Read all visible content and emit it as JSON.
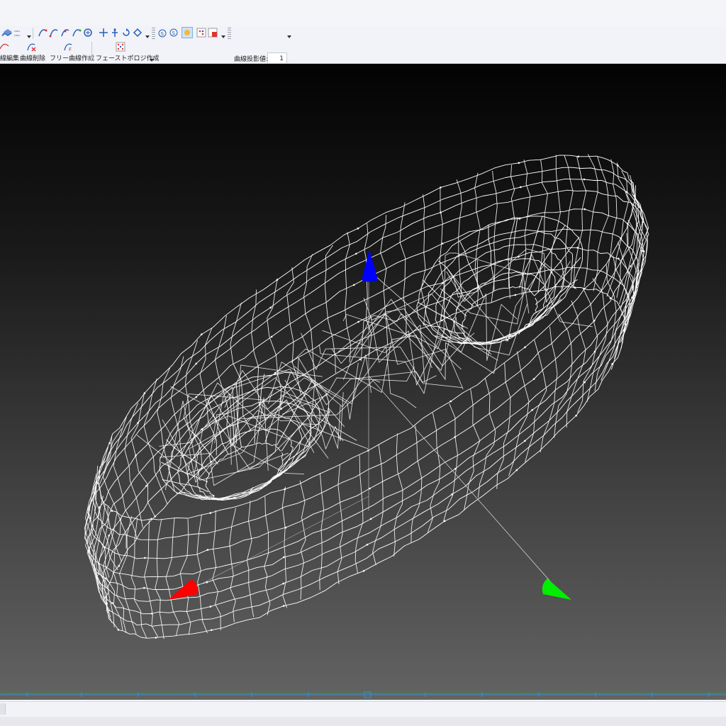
{
  "toolbar": {
    "projection_label": "曲線投影値:",
    "projection_value": "1",
    "ribbon": [
      {
        "id": "edit",
        "label": "線編集"
      },
      {
        "id": "delete",
        "label": "曲線削除"
      },
      {
        "id": "free",
        "label": "フリー曲線作成"
      },
      {
        "id": "face",
        "label": "フェーストポロジ作成"
      }
    ]
  },
  "colors": {
    "axis_x": "#ff0000",
    "axis_y": "#00ee00",
    "axis_z": "#0000ff",
    "wireframe": "#ffffff"
  },
  "icons": [
    "layer-icon",
    "curve-point-icon",
    "rotate-icon",
    "snap-icon",
    "shade-icon",
    "grid-icon"
  ]
}
